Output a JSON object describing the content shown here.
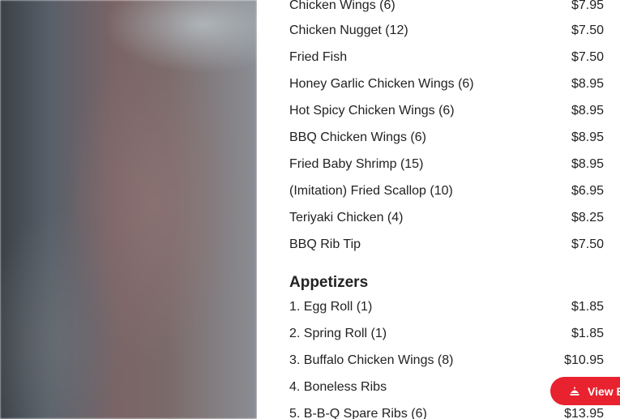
{
  "top_section": {
    "items": [
      {
        "name": "Chicken Wings (6)",
        "price": "$7.95"
      },
      {
        "name": "Chicken Nugget (12)",
        "price": "$7.50"
      },
      {
        "name": "Fried Fish",
        "price": "$7.50"
      },
      {
        "name": "Honey Garlic Chicken Wings (6)",
        "price": "$8.95"
      },
      {
        "name": "Hot Spicy Chicken Wings (6)",
        "price": "$8.95"
      },
      {
        "name": "BBQ Chicken Wings (6)",
        "price": "$8.95"
      },
      {
        "name": "Fried Baby Shrimp (15)",
        "price": "$8.95"
      },
      {
        "name": "(Imitation) Fried Scallop (10)",
        "price": "$6.95"
      },
      {
        "name": "Teriyaki Chicken (4)",
        "price": "$8.25"
      },
      {
        "name": "BBQ Rib Tip",
        "price": "$7.50"
      }
    ]
  },
  "appetizers": {
    "title": "Appetizers",
    "items": [
      {
        "name": "1. Egg Roll (1)",
        "price": "$1.85"
      },
      {
        "name": "2. Spring Roll (1)",
        "price": "$1.85"
      },
      {
        "name": "3. Buffalo Chicken Wings (8)",
        "price": "$10.95"
      },
      {
        "name": "4. Boneless Ribs",
        "price": ""
      },
      {
        "name": "5. B-B-Q Spare Ribs (6)",
        "price": "$13.95"
      }
    ]
  },
  "cart_button": {
    "label": "View Bag",
    "icon": "bag-icon",
    "color": "#e8222e"
  }
}
